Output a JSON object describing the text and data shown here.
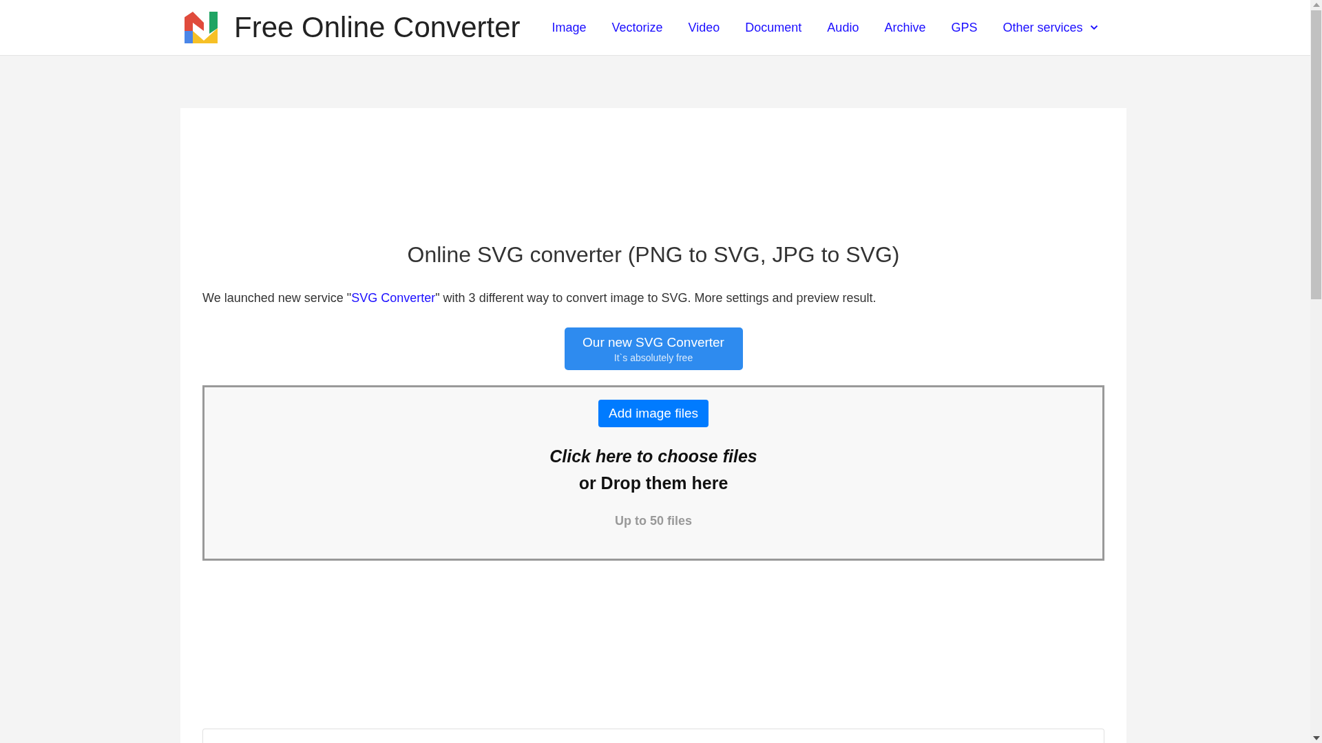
{
  "header": {
    "site_title": "Free Online Converter",
    "nav": [
      {
        "label": "Image",
        "has_dropdown": false
      },
      {
        "label": "Vectorize",
        "has_dropdown": false
      },
      {
        "label": "Video",
        "has_dropdown": false
      },
      {
        "label": "Document",
        "has_dropdown": false
      },
      {
        "label": "Audio",
        "has_dropdown": false
      },
      {
        "label": "Archive",
        "has_dropdown": false
      },
      {
        "label": "GPS",
        "has_dropdown": false
      },
      {
        "label": "Other services",
        "has_dropdown": true
      }
    ]
  },
  "main": {
    "heading": "Online SVG converter (PNG to SVG, JPG to SVG)",
    "intro": {
      "before": "We launched new service \"",
      "link": "SVG Converter",
      "after": "\" with 3 different way to convert image to SVG. More settings and preview result."
    },
    "promo_button": {
      "label": "Our new SVG Converter",
      "sublabel": "It`s absolutely free"
    },
    "dropzone": {
      "button": "Add image files",
      "choose_text": "Click here to choose files",
      "drop_text": "or Drop them here",
      "limit": "Up to 50 files"
    }
  }
}
